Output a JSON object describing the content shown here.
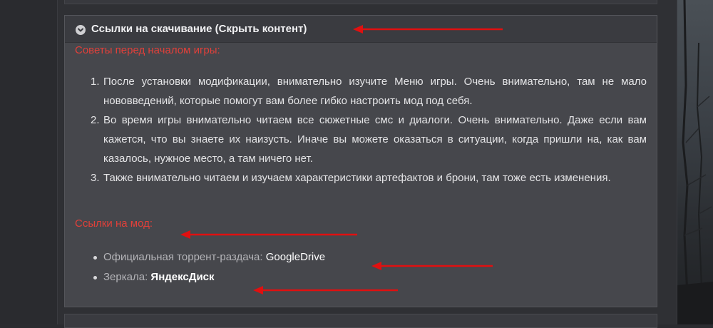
{
  "spoiler": {
    "title": "Ссылки на скачивание (Скрыть контент)",
    "icon": "chevron-down-circle-icon",
    "tips_heading": "Советы перед началом игры:",
    "tips": [
      {
        "num": "1.",
        "text": "После установки модификации, внимательно изучите Меню игры. Очень внимательно, там не мало нововведений, которые помогут вам более гибко настроить мод под себя."
      },
      {
        "num": "2.",
        "text": "Во время игры внимательно читаем все сюжетные смс и диалоги. Очень внимательно. Даже если вам кажется, что вы знаете их наизусть. Иначе вы можете оказаться в ситуации, когда пришли на, как вам казалось, нужное место, а там ничего нет."
      },
      {
        "num": "3.",
        "text": "Также внимательно читаем и изучаем характеристики артефактов и брони, там тоже есть изменения."
      }
    ],
    "links_heading": "Ссылки на мод:",
    "links": [
      {
        "label": "Официальная торрент-раздача: ",
        "link": "GoogleDrive"
      },
      {
        "label": "Зеркала: ",
        "link": "ЯндексДиск"
      }
    ]
  },
  "colors": {
    "accent_red": "#e0403a",
    "arrow_red": "#e01010",
    "panel": "#46474c",
    "header": "#3a3b40"
  }
}
